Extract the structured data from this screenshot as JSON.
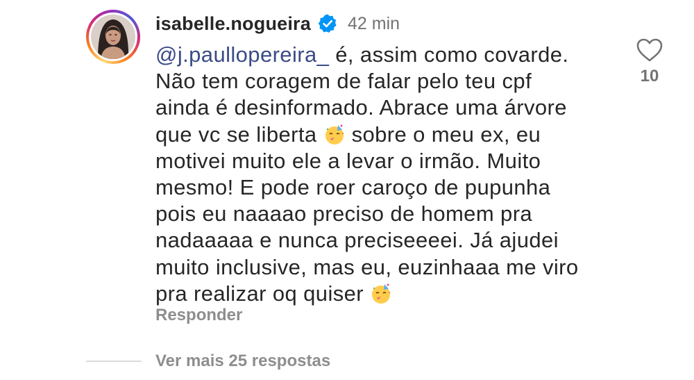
{
  "comment": {
    "username": "isabelle.nogueira",
    "verified": true,
    "timestamp": "42 min",
    "mention": "@j.paullopereira_",
    "lines": [
      " é, assim como covarde.",
      "Não tem coragem de falar pelo teu cpf",
      "ainda é desinformado. Abrace uma árvore",
      "que vc se liberta",
      " sobre o meu ex, eu",
      "motivei muito ele a levar o irmão. Muito",
      "mesmo! E pode roer caroço de pupunha",
      "pois eu naaaao preciso de homem pra",
      "nadaaaaa e nunca preciseeeei. Já ajudei",
      "muito inclusive, mas eu, euzinhaaa me viro",
      "pra realizar oq quiser"
    ],
    "emoji_icon": "party-face-icon",
    "reply_label": "Responder",
    "like_count": "10",
    "like_icon": "heart-outline-icon"
  },
  "thread": {
    "more_replies_label": "Ver mais 25 respostas"
  },
  "colors": {
    "text": "#262626",
    "mention": "#3a4b86",
    "muted": "#8e8e8e",
    "verified": "#0095f6"
  }
}
